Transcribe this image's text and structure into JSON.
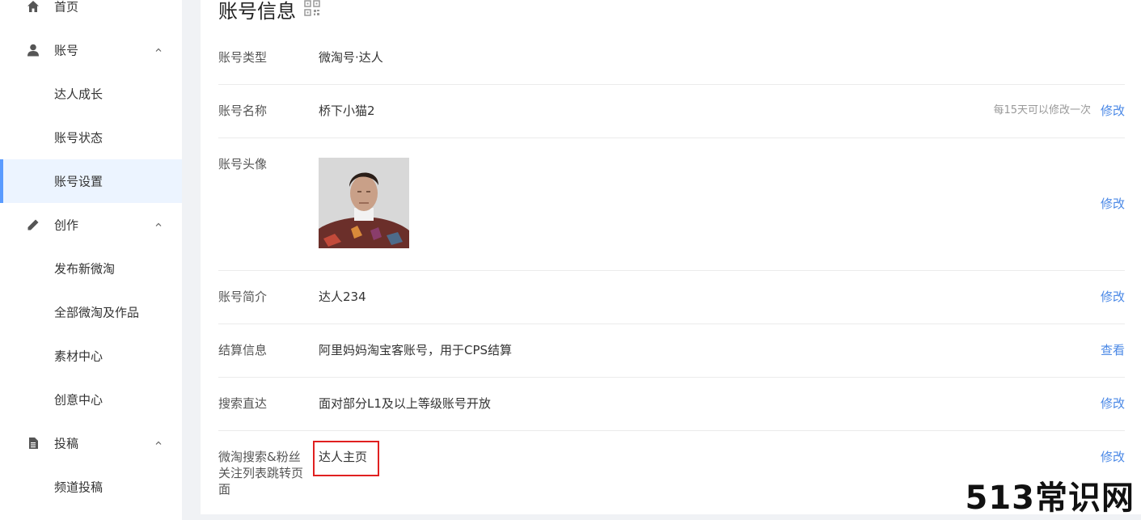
{
  "sidebar": {
    "home": {
      "label": "首页",
      "icon": "home-icon"
    },
    "account": {
      "label": "账号",
      "icon": "user-icon",
      "caret": "chevron-up-icon",
      "items": [
        {
          "label": "达人成长"
        },
        {
          "label": "账号状态"
        },
        {
          "label": "账号设置"
        }
      ]
    },
    "create": {
      "label": "创作",
      "icon": "pencil-icon",
      "caret": "chevron-up-icon",
      "items": [
        {
          "label": "发布新微淘"
        },
        {
          "label": "全部微淘及作品"
        },
        {
          "label": "素材中心"
        },
        {
          "label": "创意中心"
        }
      ]
    },
    "submit": {
      "label": "投稿",
      "icon": "document-icon",
      "caret": "chevron-up-icon",
      "items": [
        {
          "label": "频道投稿"
        }
      ]
    }
  },
  "main": {
    "title": "账号信息",
    "rows": {
      "type": {
        "label": "账号类型",
        "value": "微淘号·达人"
      },
      "name": {
        "label": "账号名称",
        "value": "桥下小猫2",
        "hint": "每15天可以修改一次",
        "action": "修改"
      },
      "avatar": {
        "label": "账号头像",
        "action": "修改"
      },
      "intro": {
        "label": "账号简介",
        "value": "达人234",
        "action": "修改"
      },
      "settlement": {
        "label": "结算信息",
        "value": "阿里妈妈淘宝客账号，用于CPS结算",
        "action": "查看"
      },
      "search": {
        "label": "搜索直达",
        "value": "面对部分L1及以上等级账号开放",
        "action": "修改"
      },
      "redirect": {
        "label_line1": "微淘搜索&粉丝",
        "label_line2": "关注列表跳转页",
        "label_line3": "面",
        "value": "达人主页",
        "action": "修改"
      }
    }
  },
  "watermark": "513常识网",
  "colors": {
    "accent": "#4a88e6",
    "active_bg": "#ecf4ff",
    "active_bar": "#5a9bff",
    "highlight": "#e02020"
  }
}
